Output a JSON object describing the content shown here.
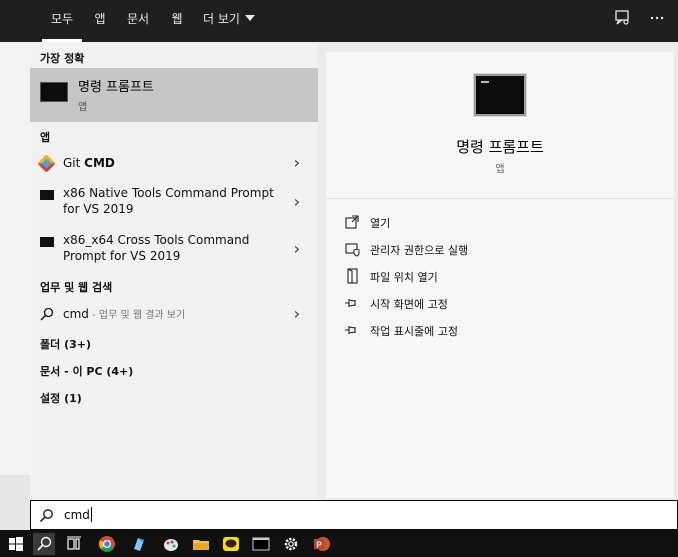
{
  "tabs": [
    {
      "label": "모두",
      "active": true
    },
    {
      "label": "앱"
    },
    {
      "label": "문서"
    },
    {
      "label": "웹"
    },
    {
      "label": "더 보기"
    }
  ],
  "top_icons": [
    "feedback-icon",
    "more-icon"
  ],
  "sections": {
    "best_match": "가장 정확",
    "apps": "앱",
    "web": "업무 및 웹 검색",
    "folders": "폴더 (3+)",
    "documents": "문서 - 이 PC (4+)",
    "settings": "설정 (1)"
  },
  "best_match": {
    "title": "명령 프롬프트",
    "subtitle": "앱"
  },
  "apps": [
    {
      "prefix": "Git ",
      "bold": "CMD",
      "line2": ""
    },
    {
      "prefix": "x86 Native Tools Command Prompt",
      "bold": "",
      "line2": "for VS 2019"
    },
    {
      "prefix": "x86_x64 Cross Tools Command",
      "bold": "",
      "line2": "Prompt for VS 2019"
    }
  ],
  "web_search": {
    "query": "cmd",
    "hint": " - 업무 및 웹 결과 보기"
  },
  "detail": {
    "title": "명령 프롬프트",
    "subtitle": "앱",
    "actions": [
      {
        "label": "열기",
        "icon": "open-icon"
      },
      {
        "label": "관리자 권한으로 실행",
        "icon": "shield-icon"
      },
      {
        "label": "파일 위치 열기",
        "icon": "file-location-icon"
      },
      {
        "label": "시작 화면에 고정",
        "icon": "pin-icon"
      },
      {
        "label": "작업 표시줄에 고정",
        "icon": "pin-icon"
      }
    ]
  },
  "search": {
    "value": "cmd"
  },
  "taskbar": [
    "windows-start-icon",
    "search-icon",
    "task-view-icon",
    "chrome-icon",
    "app-icon",
    "paint-icon",
    "file-explorer-icon",
    "kakaotalk-icon",
    "terminal-icon",
    "settings-icon",
    "powerpoint-icon"
  ]
}
